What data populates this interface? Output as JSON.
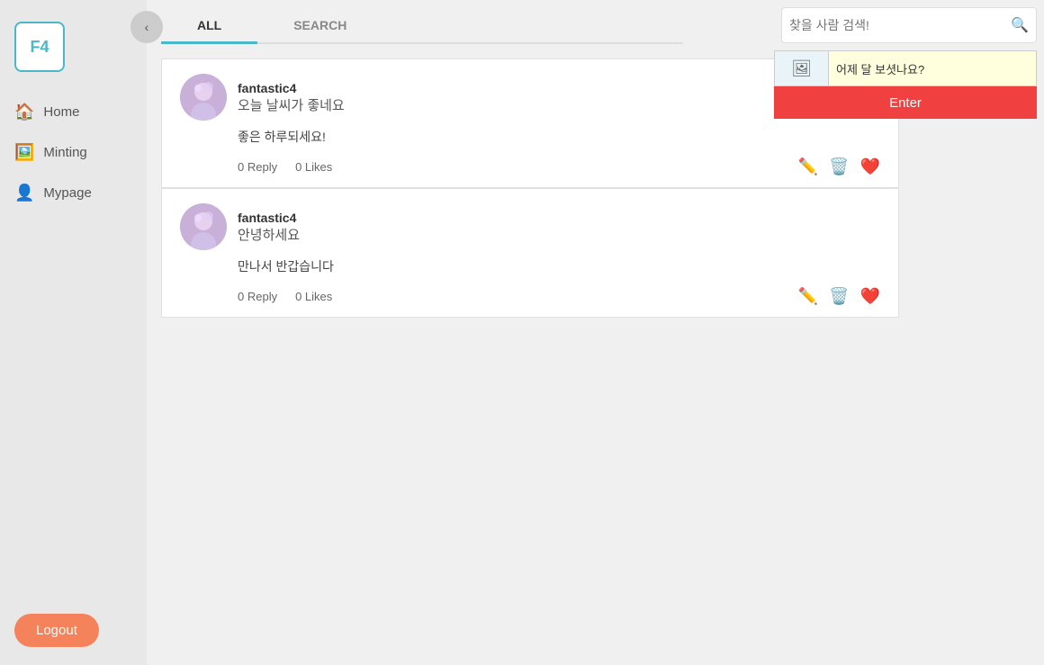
{
  "sidebar": {
    "logo": "F4",
    "nav_items": [
      {
        "id": "home",
        "label": "Home",
        "icon": "🏠"
      },
      {
        "id": "minting",
        "label": "Minting",
        "icon": "🖼️"
      },
      {
        "id": "mypage",
        "label": "Mypage",
        "icon": "👤"
      }
    ],
    "logout_label": "Logout"
  },
  "collapse_icon": "‹",
  "search": {
    "placeholder": "찾을 사람 검색!"
  },
  "post_box": {
    "input_value": "어제 달 보셧나요?",
    "enter_label": "Enter"
  },
  "tabs": [
    {
      "id": "all",
      "label": "ALL",
      "active": true
    },
    {
      "id": "search",
      "label": "SEARCH",
      "active": false
    }
  ],
  "posts": [
    {
      "id": 1,
      "username": "fantastic4",
      "title": "오늘 날씨가 좋네요",
      "body": "좋은 하루되세요!",
      "reply_count": "0 Reply",
      "likes_count": "0 Likes"
    },
    {
      "id": 2,
      "username": "fantastic4",
      "title": "안녕하세요",
      "body": "만나서 반갑습니다",
      "reply_count": "0 Reply",
      "likes_count": "0 Likes"
    }
  ]
}
